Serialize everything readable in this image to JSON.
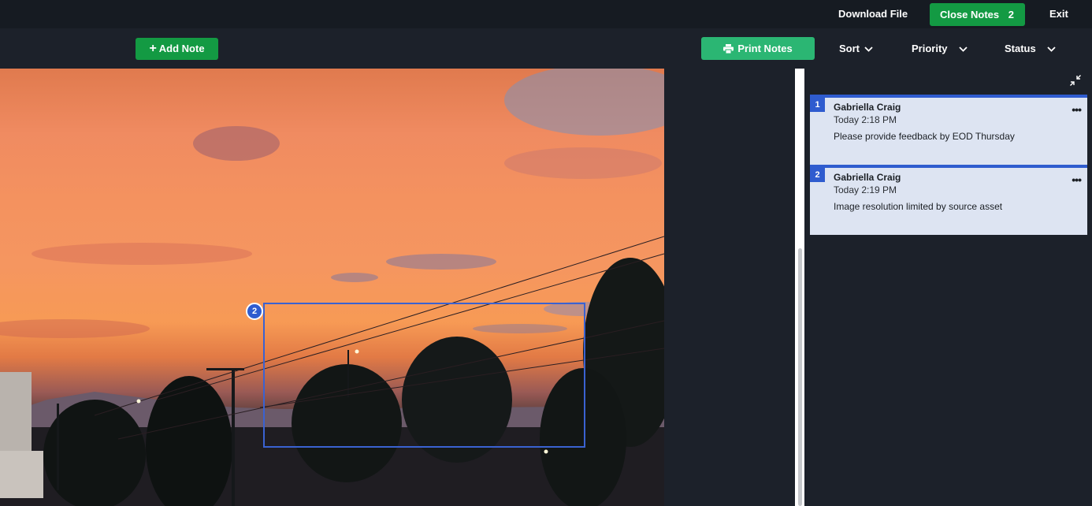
{
  "topbar": {
    "download_label": "Download File",
    "close_notes_label": "Close Notes",
    "close_notes_count": "2",
    "exit_label": "Exit"
  },
  "toolbar": {
    "add_note_label": "Add Note",
    "print_notes_label": "Print Notes",
    "sort_label": "Sort",
    "priority_label": "Priority",
    "status_label": "Status"
  },
  "annotation": {
    "marker_number": "2"
  },
  "notes": [
    {
      "number": "1",
      "author": "Gabriella Craig",
      "time": "Today 2:18 PM",
      "text": "Please provide feedback by EOD Thursday"
    },
    {
      "number": "2",
      "author": "Gabriella Craig",
      "time": "Today 2:19 PM",
      "text": "Image resolution limited by source asset"
    }
  ],
  "colors": {
    "accent_green": "#139a43",
    "print_green": "#2bb673",
    "note_blue": "#2f5ccf",
    "note_bg": "#dde4f2"
  }
}
